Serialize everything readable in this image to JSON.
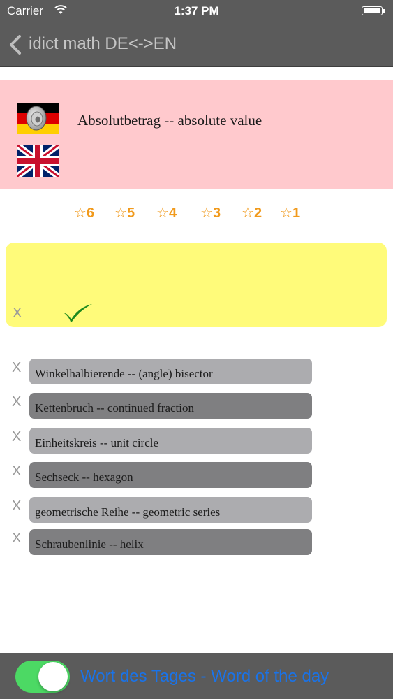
{
  "status_bar": {
    "carrier": "Carrier",
    "time": "1:37 PM"
  },
  "nav": {
    "title": "idict math DE<->EN"
  },
  "word": {
    "text": "Absolutbetrag -- absolute value",
    "source_flag": "flag-germany-icon",
    "target_flag": "flag-uk-icon"
  },
  "ratings": [
    {
      "symbol": "☆",
      "value": "6"
    },
    {
      "symbol": "☆",
      "value": "5"
    },
    {
      "symbol": "☆",
      "value": "4"
    },
    {
      "symbol": "☆",
      "value": "3"
    },
    {
      "symbol": "☆",
      "value": "2"
    },
    {
      "symbol": "☆",
      "value": "1"
    }
  ],
  "answer": {
    "clear_label": "X",
    "check_icon": "checkmark-icon"
  },
  "history": [
    {
      "remove": "X",
      "text": "Winkelhalbierende -- (angle) bisector"
    },
    {
      "remove": "X",
      "text": "Kettenbruch -- continued fraction"
    },
    {
      "remove": "X",
      "text": "Einheitskreis -- unit circle"
    },
    {
      "remove": "X",
      "text": "Sechseck -- hexagon"
    },
    {
      "remove": "X",
      "text": "geometrische Reihe -- geometric series"
    },
    {
      "remove": "X",
      "text": "Schraubenlinie -- helix"
    }
  ],
  "bottom": {
    "toggle_on": true,
    "label": "Wort des Tages - Word of the day"
  },
  "colors": {
    "bar_background": "#5b5b5b",
    "word_panel": "#ffc9cd",
    "answer_box": "#fffb7a",
    "star_orange": "#f19a1c",
    "toggle_green": "#4cd964",
    "link_blue": "#1a73e8"
  }
}
